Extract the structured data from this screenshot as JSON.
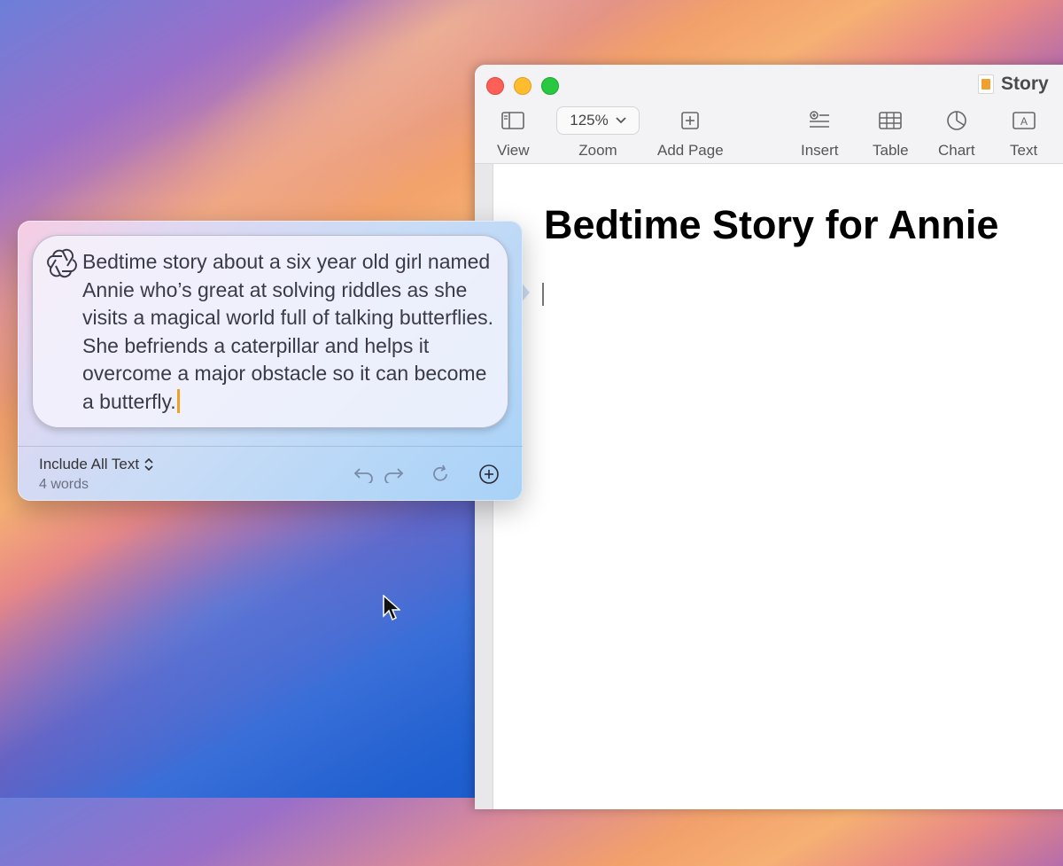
{
  "window": {
    "doc_title": "Story",
    "toolbar": {
      "view_label": "View",
      "zoom_value": "125%",
      "zoom_label": "Zoom",
      "add_page_label": "Add Page",
      "insert_label": "Insert",
      "table_label": "Table",
      "chart_label": "Chart",
      "text_label": "Text"
    },
    "document": {
      "heading": "Bedtime Story for Annie"
    }
  },
  "writing_tools": {
    "prompt_text": "Bedtime story about a six year old girl named Annie who’s great at solving riddles as she visits a magical world full of talking butterflies. She befriends a caterpillar and helps it overcome a major obstacle so it can become a butterfly.",
    "include_label": "Include All Text",
    "word_count": "4 words",
    "icons": [
      "chatgpt-icon",
      "undo-icon",
      "redo-icon",
      "refresh-icon",
      "add-circle-icon"
    ]
  },
  "colors": {
    "close": "#fe5f57",
    "minimize": "#febc2e",
    "maximize": "#28c840",
    "caret": "#f0a020"
  }
}
